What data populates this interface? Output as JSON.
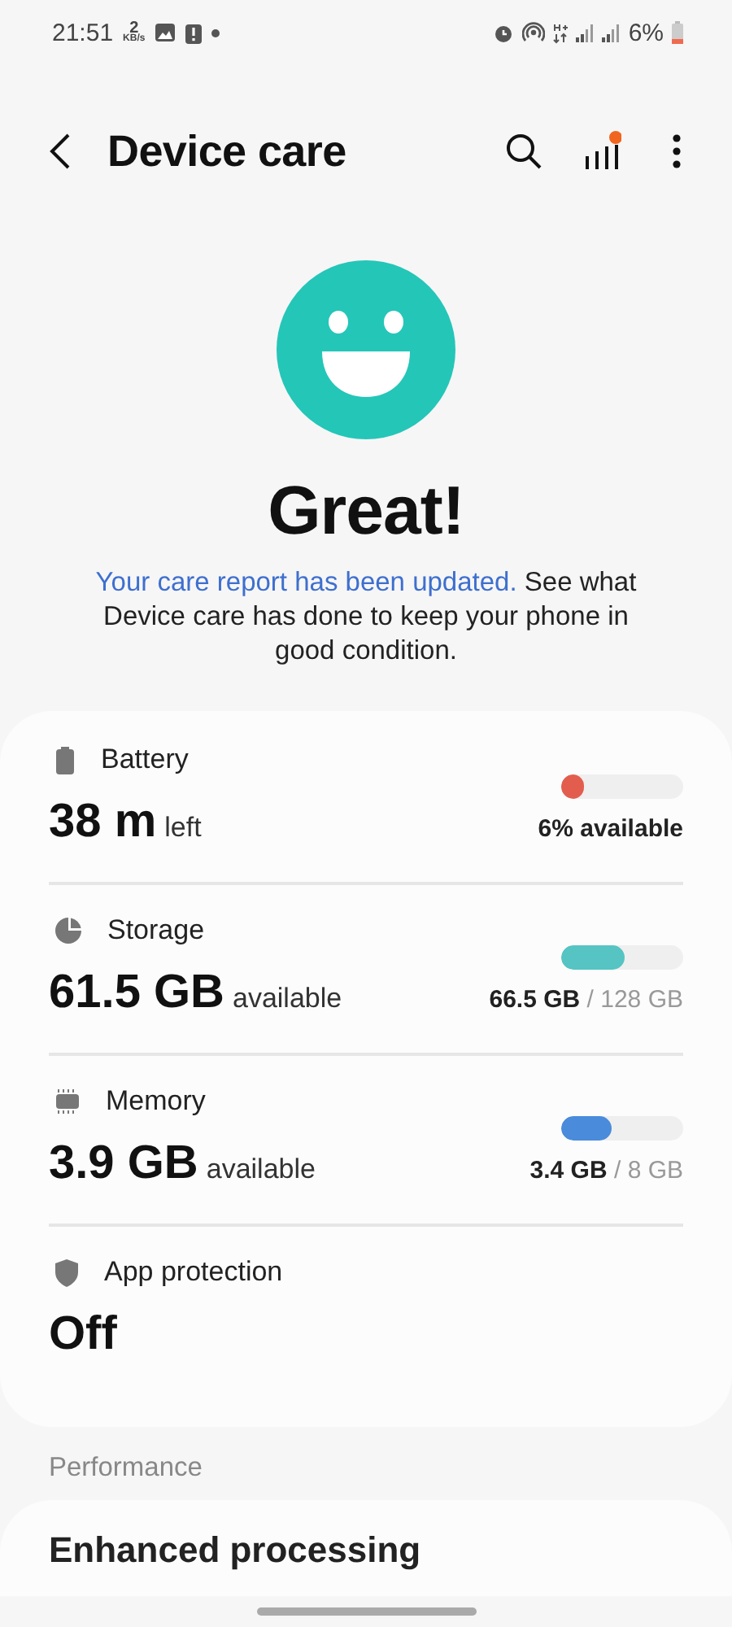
{
  "status_bar": {
    "time": "21:51",
    "speed": "2",
    "speed_unit": "KB/s",
    "battery": "6%"
  },
  "header": {
    "title": "Device care",
    "notification_dot": true
  },
  "summary": {
    "headline": "Great!",
    "link": "Your care report has been updated.",
    "text": "See what Device care has done to keep your phone in good condition."
  },
  "items": [
    {
      "kind": "meter",
      "label": "Battery",
      "value": "38 m",
      "unit": "left",
      "level": 0.06,
      "color": "#e35d4f",
      "reading": "**6% available**"
    },
    {
      "kind": "meter",
      "label": "Storage",
      "value": "61.5 GB",
      "unit": "available",
      "level": 0.52,
      "color": "#55c4c3",
      "reading": "**66.5 GB** / 128 GB"
    },
    {
      "kind": "meter",
      "label": "Memory",
      "value": "3.9 GB",
      "unit": "available",
      "level": 0.42,
      "color": "#4a8bdb",
      "reading": "**3.4 GB** / 8 GB"
    },
    {
      "kind": "status",
      "label": "App protection",
      "value": "Off"
    }
  ],
  "section": {
    "title": "Performance",
    "first_item": "Enhanced processing"
  }
}
